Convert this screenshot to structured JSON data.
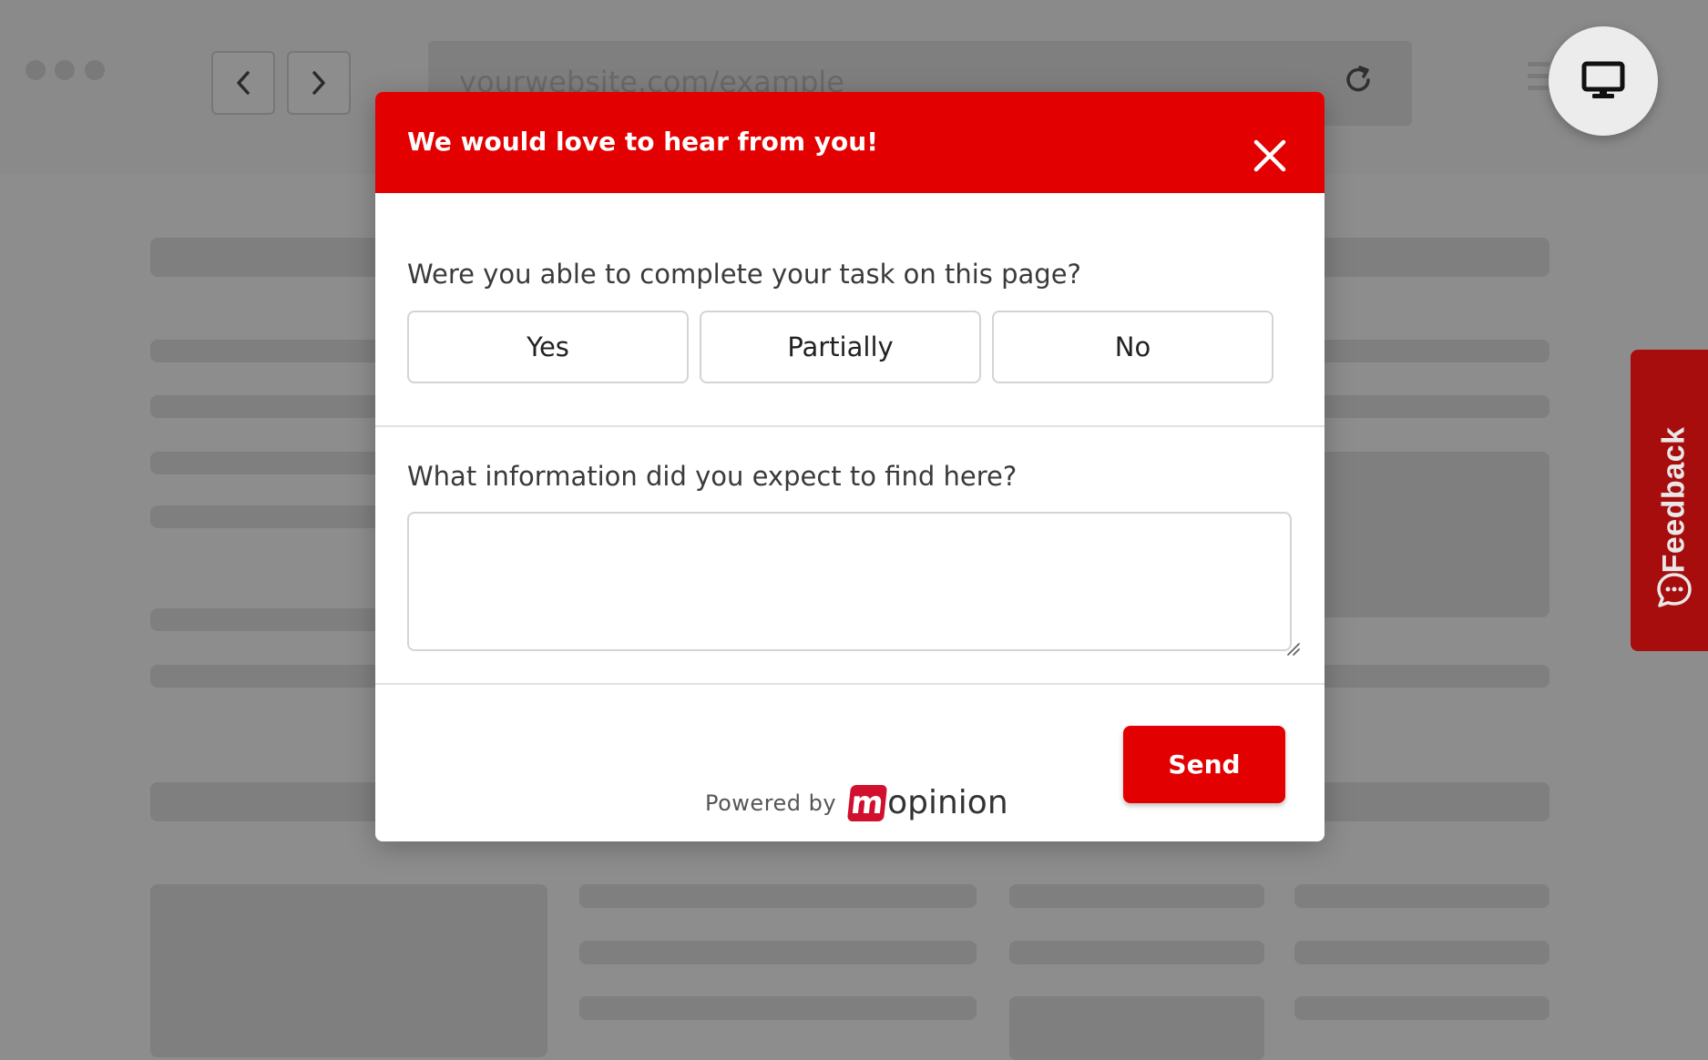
{
  "browser": {
    "url": "yourwebsite.com/example"
  },
  "feedback_tab": {
    "label": "Feedback"
  },
  "modal": {
    "title": "We would love to hear from you!",
    "question1": "Were you able to complete your task on this page?",
    "options": [
      "Yes",
      "Partially",
      "No"
    ],
    "question2": "What information did you expect to find here?",
    "answer_value": "",
    "send_label": "Send",
    "powered_by": "Powered by",
    "brand_initial": "m",
    "brand_rest": "opinion"
  },
  "colors": {
    "accent": "#e30000",
    "feedback_tab": "#a80d0d",
    "backdrop": "#8d8d8d"
  }
}
